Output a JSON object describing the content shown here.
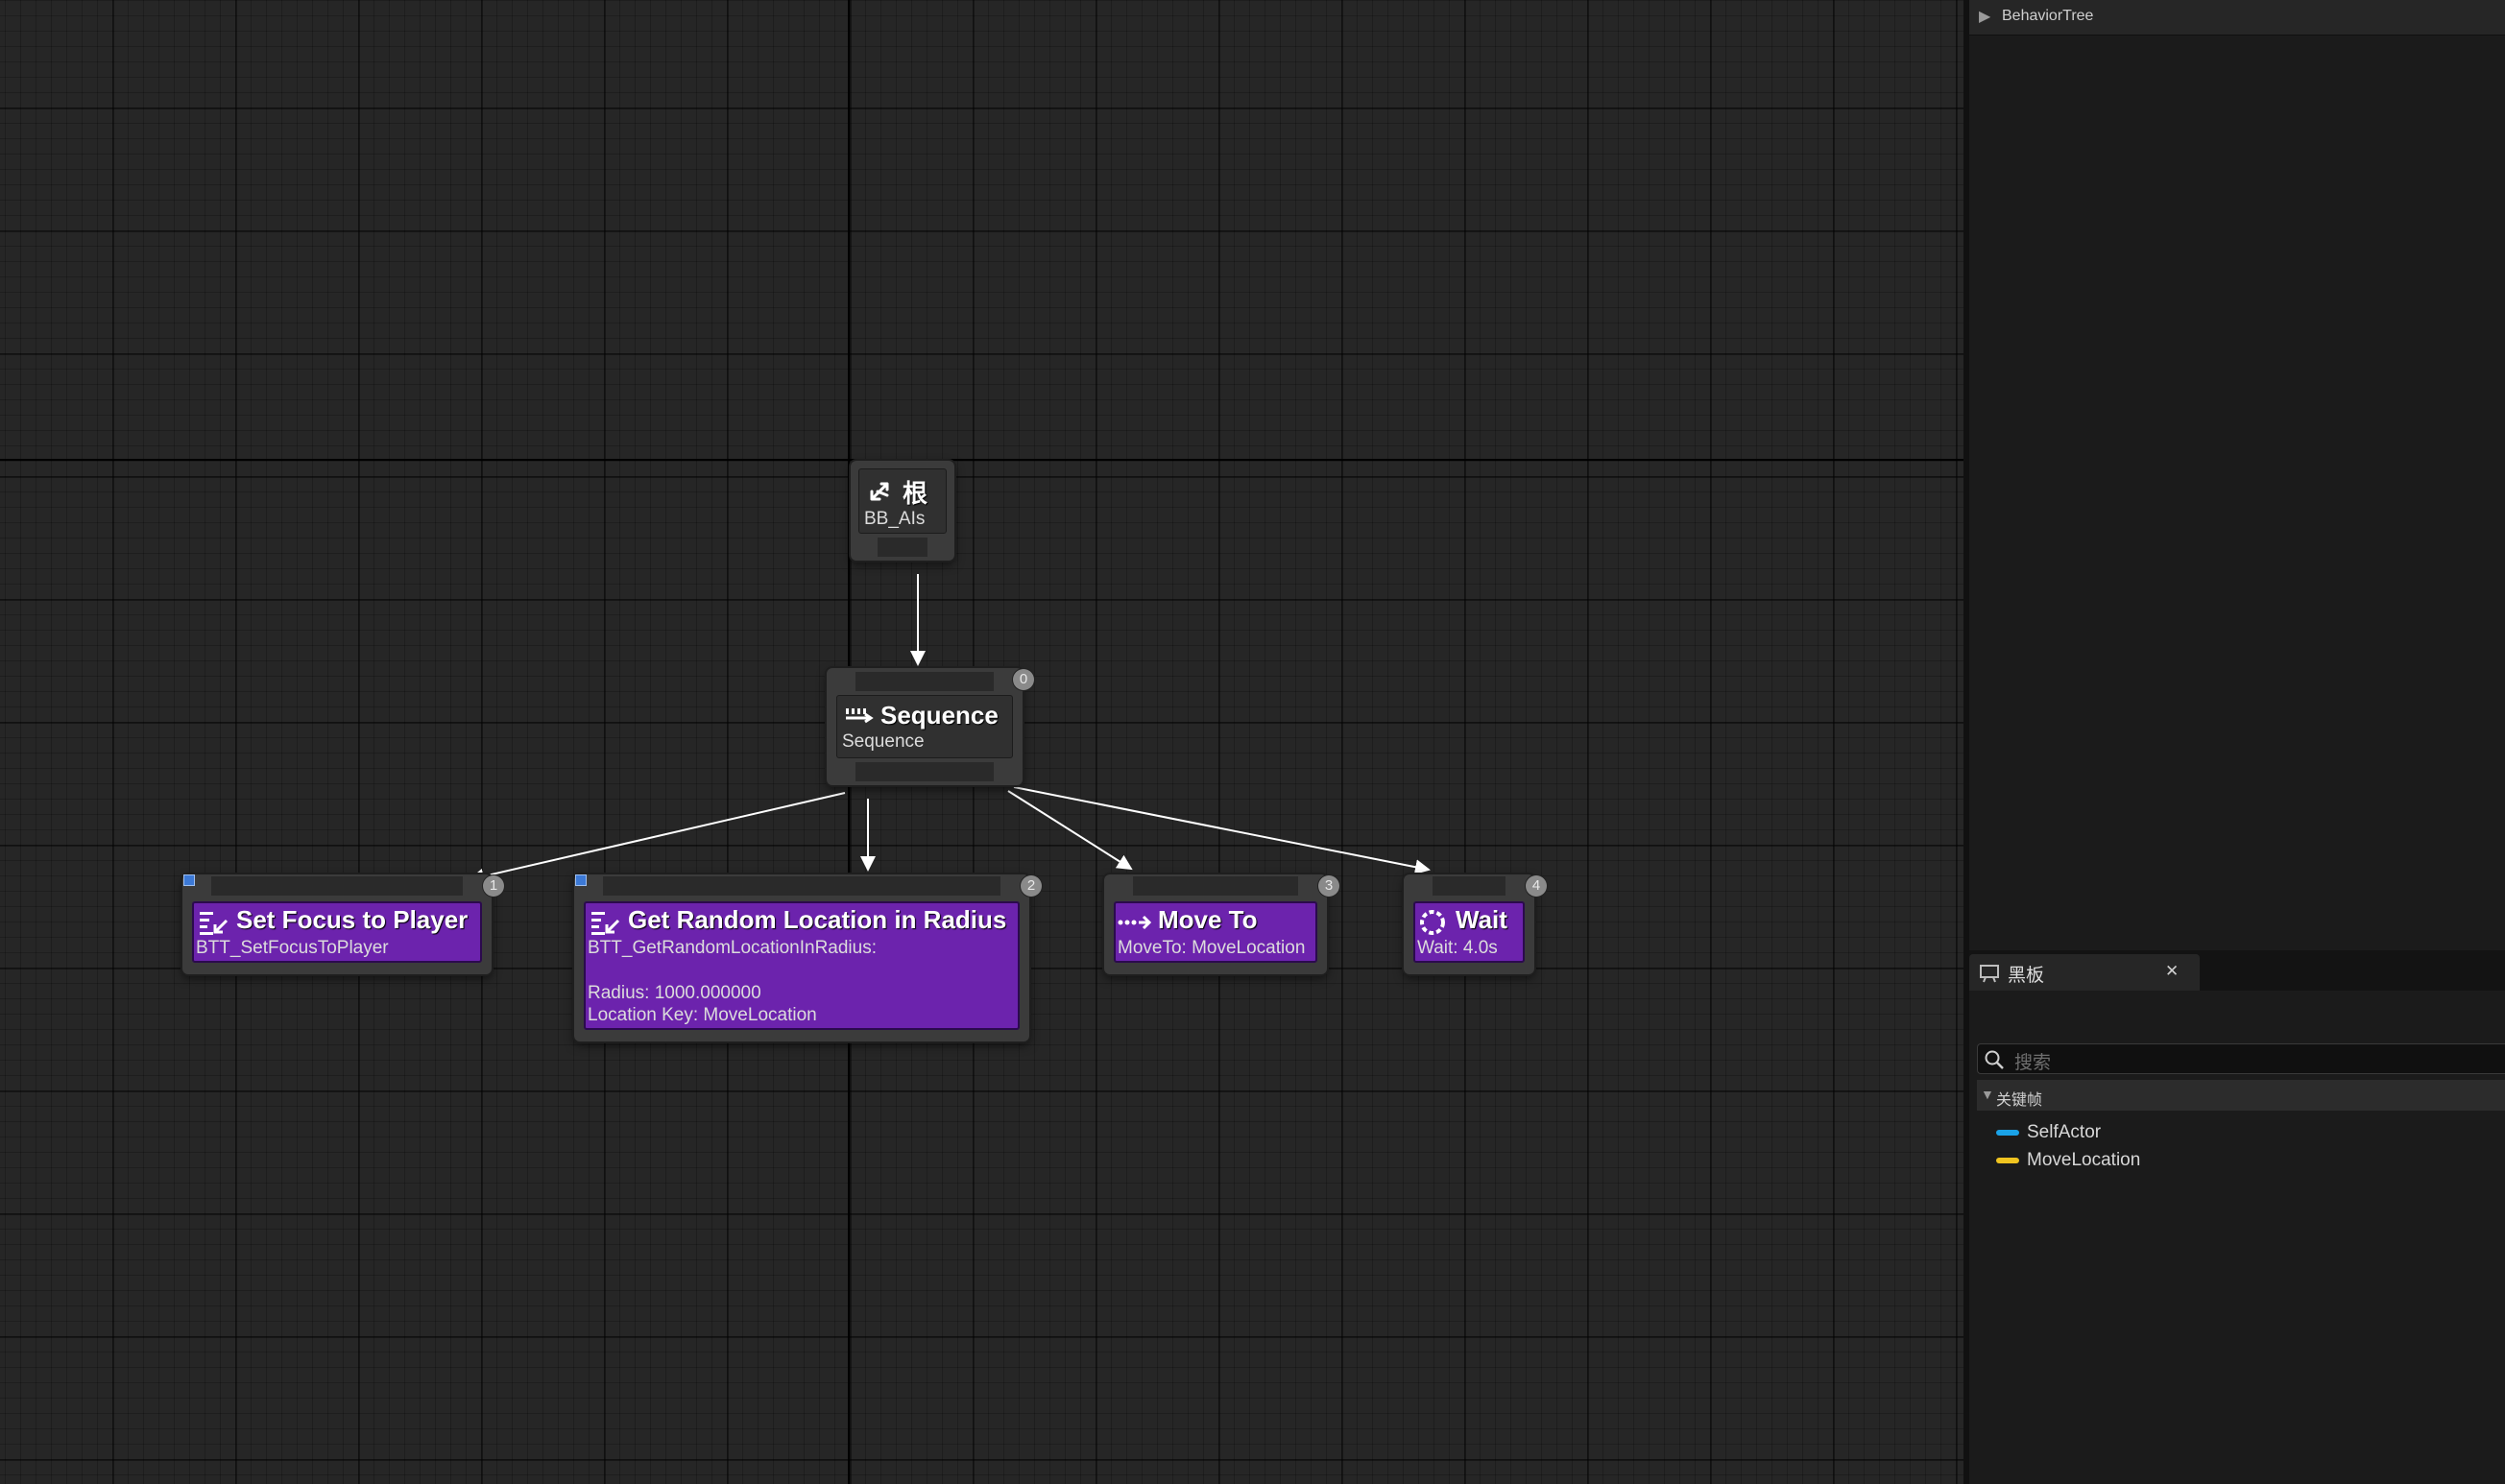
{
  "graph": {
    "root": {
      "title": "根",
      "subtitle": "BB_AIs"
    },
    "sequence": {
      "title": "Sequence",
      "subtitle": "Sequence",
      "index": "0"
    },
    "tasks": [
      {
        "title": "Set Focus to Player",
        "lines": [
          "BTT_SetFocusToPlayer"
        ],
        "index": "1"
      },
      {
        "title": "Get Random Location in Radius",
        "lines": [
          "BTT_GetRandomLocationInRadius:",
          "",
          "Radius: 1000.000000",
          "Location Key: MoveLocation"
        ],
        "index": "2"
      },
      {
        "title": "Move To",
        "lines": [
          "MoveTo: MoveLocation"
        ],
        "index": "3"
      },
      {
        "title": "Wait",
        "lines": [
          "Wait: 4.0s"
        ],
        "index": "4"
      }
    ],
    "colors": {
      "task_purple": "#6c23ad",
      "edge": "#ffffff"
    }
  },
  "details": {
    "header": "BehaviorTree"
  },
  "blackboard": {
    "tab_label": "黑板",
    "close_glyph": "✕",
    "search_placeholder": "搜索",
    "category": "关键帧",
    "keys": [
      {
        "name": "SelfActor",
        "color": "#1aa3e8"
      },
      {
        "name": "MoveLocation",
        "color": "#f0c420"
      }
    ]
  }
}
